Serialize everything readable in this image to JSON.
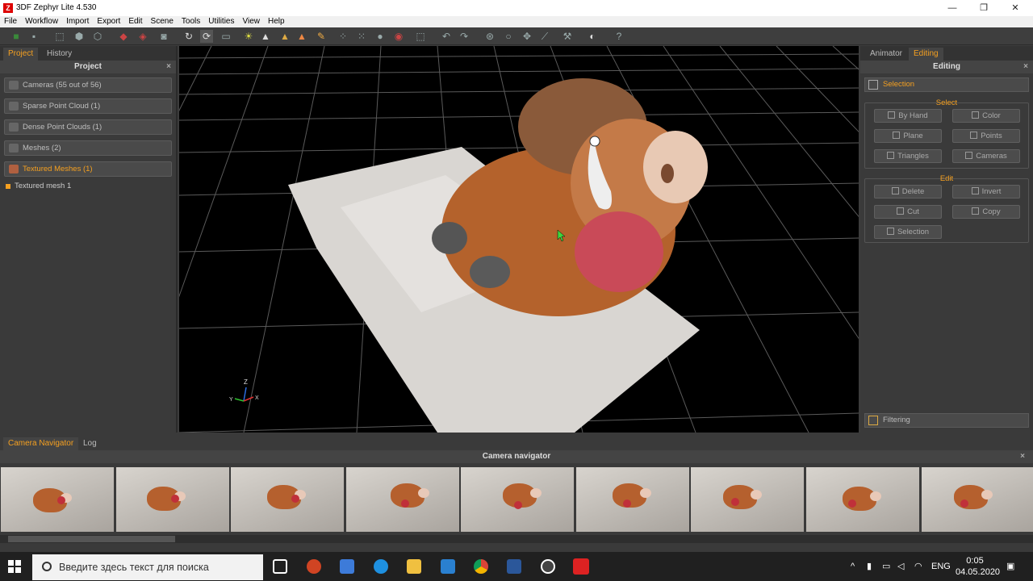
{
  "window": {
    "title": "3DF Zephyr Lite 4.530",
    "minimize": "—",
    "maximize": "❐",
    "close": "✕"
  },
  "menu": [
    "File",
    "Workflow",
    "Import",
    "Export",
    "Edit",
    "Scene",
    "Tools",
    "Utilities",
    "View",
    "Help"
  ],
  "left_panel": {
    "tabs": [
      "Project",
      "History"
    ],
    "header": "Project",
    "close": "×",
    "items": [
      "Cameras (55 out of 56)",
      "Sparse Point Cloud (1)",
      "Dense Point Clouds (1)",
      "Meshes (2)",
      "Textured Meshes (1)"
    ],
    "subitem": "Textured mesh 1"
  },
  "viewport": {
    "axis_z": "Z",
    "axis_y": "Y",
    "axis_x": "X"
  },
  "right_panel": {
    "tabs": [
      "Animator",
      "Editing"
    ],
    "header": "Editing",
    "close": "×",
    "selection_label": "Selection",
    "select_group": "Select",
    "select_buttons": [
      "By Hand",
      "Color",
      "Plane",
      "Points",
      "Triangles",
      "Cameras"
    ],
    "edit_group": "Edit",
    "edit_buttons": [
      "Delete",
      "Invert",
      "Cut",
      "Copy",
      "Selection"
    ],
    "filtering_label": "Filtering"
  },
  "bottom": {
    "tabs": [
      "Camera Navigator",
      "Log"
    ],
    "header": "Camera navigator",
    "close": "×",
    "thumbnail_count": 9
  },
  "taskbar": {
    "search_placeholder": "Введите здесь текст для поиска",
    "lang": "ENG",
    "time": "0:05",
    "date": "04.05.2020"
  },
  "colors": {
    "accent": "#f5a020",
    "panel": "#3a3a3a",
    "viewport": "#000000"
  }
}
